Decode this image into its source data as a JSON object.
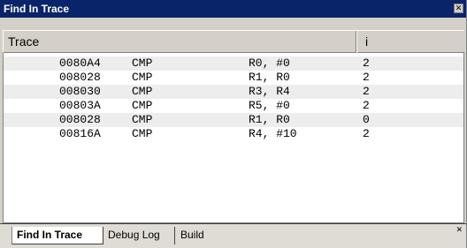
{
  "window": {
    "title": "Find In Trace",
    "close_icon": "close-icon"
  },
  "table": {
    "columns": [
      "Trace",
      "i"
    ],
    "rows": [
      {
        "address": "0080A4",
        "opcode": "CMP",
        "operands": "R0, #0",
        "i": "2",
        "highlighted": true
      },
      {
        "address": "008028",
        "opcode": "CMP",
        "operands": "R1, R0",
        "i": "2",
        "highlighted": false
      },
      {
        "address": "008030",
        "opcode": "CMP",
        "operands": "R3, R4",
        "i": "2",
        "highlighted": true
      },
      {
        "address": "00803A",
        "opcode": "CMP",
        "operands": "R5, #0",
        "i": "2",
        "highlighted": false
      },
      {
        "address": "008028",
        "opcode": "CMP",
        "operands": "R1, R0",
        "i": "0",
        "highlighted": true
      },
      {
        "address": "00816A",
        "opcode": "CMP",
        "operands": "R4, #10",
        "i": "2",
        "highlighted": false
      }
    ]
  },
  "tabs": [
    {
      "label": "Find In Trace",
      "active": true
    },
    {
      "label": "Debug Log",
      "active": false
    },
    {
      "label": "Build",
      "active": false
    }
  ],
  "colors": {
    "titlebar": "#0a246a",
    "chrome": "#d4d0c8"
  }
}
